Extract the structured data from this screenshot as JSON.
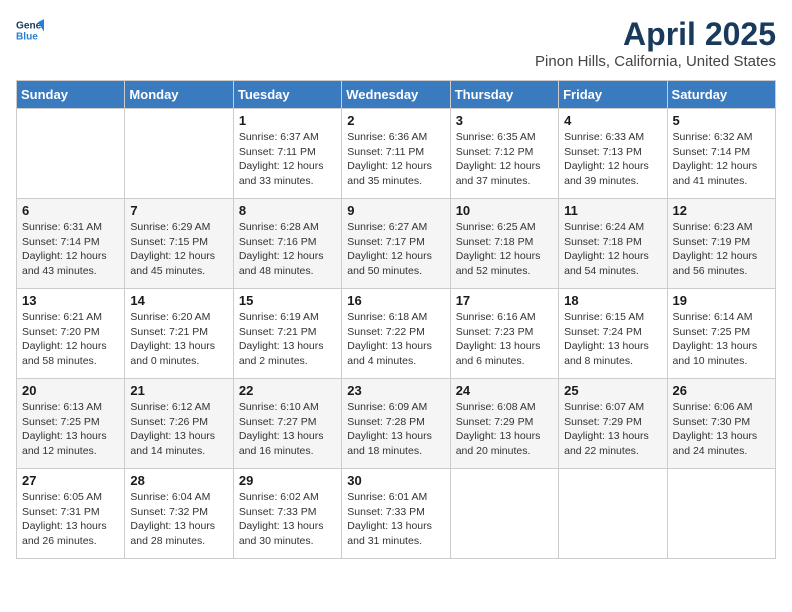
{
  "logo": {
    "line1": "General",
    "line2": "Blue"
  },
  "title": "April 2025",
  "subtitle": "Pinon Hills, California, United States",
  "days_of_week": [
    "Sunday",
    "Monday",
    "Tuesday",
    "Wednesday",
    "Thursday",
    "Friday",
    "Saturday"
  ],
  "weeks": [
    [
      {
        "day": "",
        "info": ""
      },
      {
        "day": "",
        "info": ""
      },
      {
        "day": "1",
        "info": "Sunrise: 6:37 AM\nSunset: 7:11 PM\nDaylight: 12 hours and 33 minutes."
      },
      {
        "day": "2",
        "info": "Sunrise: 6:36 AM\nSunset: 7:11 PM\nDaylight: 12 hours and 35 minutes."
      },
      {
        "day": "3",
        "info": "Sunrise: 6:35 AM\nSunset: 7:12 PM\nDaylight: 12 hours and 37 minutes."
      },
      {
        "day": "4",
        "info": "Sunrise: 6:33 AM\nSunset: 7:13 PM\nDaylight: 12 hours and 39 minutes."
      },
      {
        "day": "5",
        "info": "Sunrise: 6:32 AM\nSunset: 7:14 PM\nDaylight: 12 hours and 41 minutes."
      }
    ],
    [
      {
        "day": "6",
        "info": "Sunrise: 6:31 AM\nSunset: 7:14 PM\nDaylight: 12 hours and 43 minutes."
      },
      {
        "day": "7",
        "info": "Sunrise: 6:29 AM\nSunset: 7:15 PM\nDaylight: 12 hours and 45 minutes."
      },
      {
        "day": "8",
        "info": "Sunrise: 6:28 AM\nSunset: 7:16 PM\nDaylight: 12 hours and 48 minutes."
      },
      {
        "day": "9",
        "info": "Sunrise: 6:27 AM\nSunset: 7:17 PM\nDaylight: 12 hours and 50 minutes."
      },
      {
        "day": "10",
        "info": "Sunrise: 6:25 AM\nSunset: 7:18 PM\nDaylight: 12 hours and 52 minutes."
      },
      {
        "day": "11",
        "info": "Sunrise: 6:24 AM\nSunset: 7:18 PM\nDaylight: 12 hours and 54 minutes."
      },
      {
        "day": "12",
        "info": "Sunrise: 6:23 AM\nSunset: 7:19 PM\nDaylight: 12 hours and 56 minutes."
      }
    ],
    [
      {
        "day": "13",
        "info": "Sunrise: 6:21 AM\nSunset: 7:20 PM\nDaylight: 12 hours and 58 minutes."
      },
      {
        "day": "14",
        "info": "Sunrise: 6:20 AM\nSunset: 7:21 PM\nDaylight: 13 hours and 0 minutes."
      },
      {
        "day": "15",
        "info": "Sunrise: 6:19 AM\nSunset: 7:21 PM\nDaylight: 13 hours and 2 minutes."
      },
      {
        "day": "16",
        "info": "Sunrise: 6:18 AM\nSunset: 7:22 PM\nDaylight: 13 hours and 4 minutes."
      },
      {
        "day": "17",
        "info": "Sunrise: 6:16 AM\nSunset: 7:23 PM\nDaylight: 13 hours and 6 minutes."
      },
      {
        "day": "18",
        "info": "Sunrise: 6:15 AM\nSunset: 7:24 PM\nDaylight: 13 hours and 8 minutes."
      },
      {
        "day": "19",
        "info": "Sunrise: 6:14 AM\nSunset: 7:25 PM\nDaylight: 13 hours and 10 minutes."
      }
    ],
    [
      {
        "day": "20",
        "info": "Sunrise: 6:13 AM\nSunset: 7:25 PM\nDaylight: 13 hours and 12 minutes."
      },
      {
        "day": "21",
        "info": "Sunrise: 6:12 AM\nSunset: 7:26 PM\nDaylight: 13 hours and 14 minutes."
      },
      {
        "day": "22",
        "info": "Sunrise: 6:10 AM\nSunset: 7:27 PM\nDaylight: 13 hours and 16 minutes."
      },
      {
        "day": "23",
        "info": "Sunrise: 6:09 AM\nSunset: 7:28 PM\nDaylight: 13 hours and 18 minutes."
      },
      {
        "day": "24",
        "info": "Sunrise: 6:08 AM\nSunset: 7:29 PM\nDaylight: 13 hours and 20 minutes."
      },
      {
        "day": "25",
        "info": "Sunrise: 6:07 AM\nSunset: 7:29 PM\nDaylight: 13 hours and 22 minutes."
      },
      {
        "day": "26",
        "info": "Sunrise: 6:06 AM\nSunset: 7:30 PM\nDaylight: 13 hours and 24 minutes."
      }
    ],
    [
      {
        "day": "27",
        "info": "Sunrise: 6:05 AM\nSunset: 7:31 PM\nDaylight: 13 hours and 26 minutes."
      },
      {
        "day": "28",
        "info": "Sunrise: 6:04 AM\nSunset: 7:32 PM\nDaylight: 13 hours and 28 minutes."
      },
      {
        "day": "29",
        "info": "Sunrise: 6:02 AM\nSunset: 7:33 PM\nDaylight: 13 hours and 30 minutes."
      },
      {
        "day": "30",
        "info": "Sunrise: 6:01 AM\nSunset: 7:33 PM\nDaylight: 13 hours and 31 minutes."
      },
      {
        "day": "",
        "info": ""
      },
      {
        "day": "",
        "info": ""
      },
      {
        "day": "",
        "info": ""
      }
    ]
  ]
}
